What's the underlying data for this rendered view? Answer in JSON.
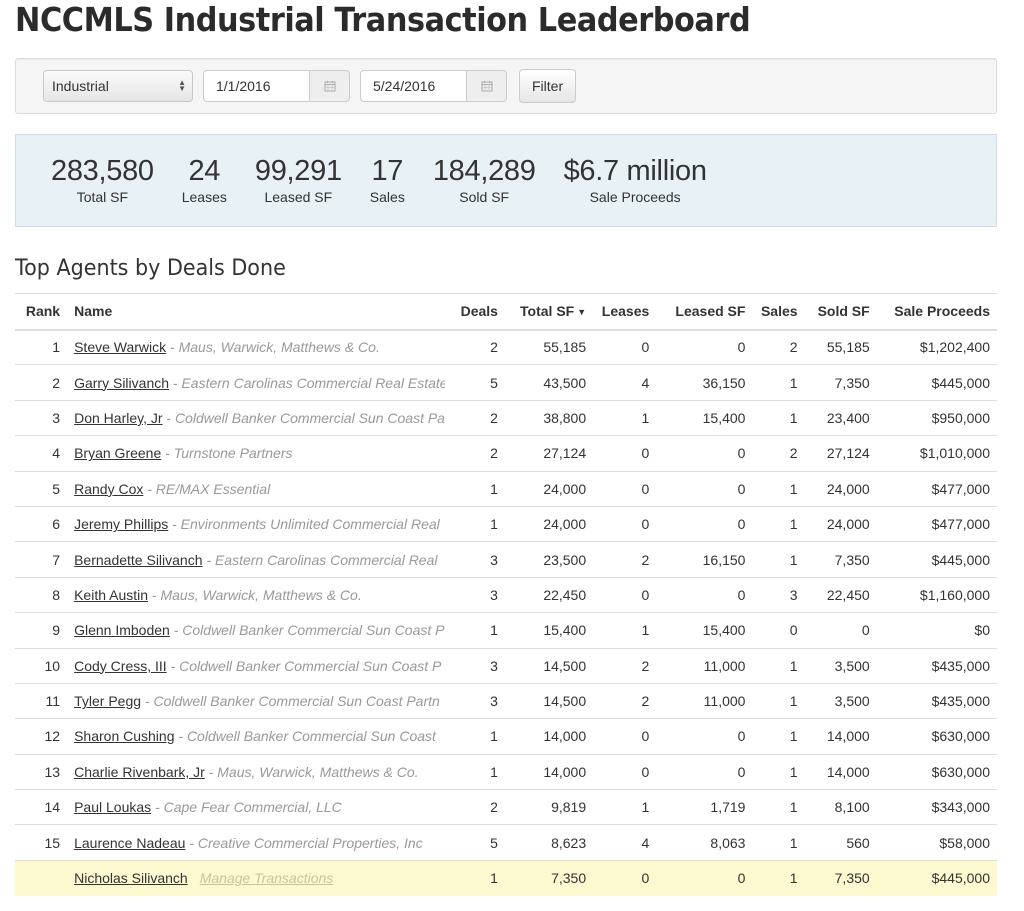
{
  "page": {
    "title": "NCCMLS Industrial Transaction Leaderboard",
    "section_title": "Top Agents by Deals Done"
  },
  "filters": {
    "property_type": "Industrial",
    "start_date": "1/1/2016",
    "end_date": "5/24/2016",
    "filter_label": "Filter",
    "calendar_icon": "calendar-icon"
  },
  "stats": [
    {
      "value": "283,580",
      "label": "Total SF"
    },
    {
      "value": "24",
      "label": "Leases"
    },
    {
      "value": "99,291",
      "label": "Leased SF"
    },
    {
      "value": "17",
      "label": "Sales"
    },
    {
      "value": "184,289",
      "label": "Sold SF"
    },
    {
      "value": "$6.7 million",
      "label": "Sale Proceeds"
    }
  ],
  "table": {
    "columns": [
      "Rank",
      "Name",
      "Deals",
      "Total SF",
      "Leases",
      "Leased SF",
      "Sales",
      "Sold SF",
      "Sale Proceeds"
    ],
    "sorted_column": "Total SF",
    "sort_direction": "descending",
    "rows": [
      {
        "rank": "1",
        "name": "Steve Warwick",
        "company": "Maus, Warwick, Matthews & Co.",
        "deals": "2",
        "total_sf": "55,185",
        "leases": "0",
        "leased_sf": "0",
        "sales": "2",
        "sold_sf": "55,185",
        "proceeds": "$1,202,400"
      },
      {
        "rank": "2",
        "name": "Garry Silivanch",
        "company": "Eastern Carolinas Commercial Real Estate",
        "deals": "5",
        "total_sf": "43,500",
        "leases": "4",
        "leased_sf": "36,150",
        "sales": "1",
        "sold_sf": "7,350",
        "proceeds": "$445,000"
      },
      {
        "rank": "3",
        "name": "Don Harley, Jr",
        "company": "Coldwell Banker Commercial Sun Coast Pa",
        "deals": "2",
        "total_sf": "38,800",
        "leases": "1",
        "leased_sf": "15,400",
        "sales": "1",
        "sold_sf": "23,400",
        "proceeds": "$950,000"
      },
      {
        "rank": "4",
        "name": "Bryan Greene",
        "company": "Turnstone Partners",
        "deals": "2",
        "total_sf": "27,124",
        "leases": "0",
        "leased_sf": "0",
        "sales": "2",
        "sold_sf": "27,124",
        "proceeds": "$1,010,000"
      },
      {
        "rank": "5",
        "name": "Randy Cox",
        "company": "RE/MAX Essential",
        "deals": "1",
        "total_sf": "24,000",
        "leases": "0",
        "leased_sf": "0",
        "sales": "1",
        "sold_sf": "24,000",
        "proceeds": "$477,000"
      },
      {
        "rank": "6",
        "name": "Jeremy Phillips",
        "company": "Environments Unlimited Commercial Real",
        "deals": "1",
        "total_sf": "24,000",
        "leases": "0",
        "leased_sf": "0",
        "sales": "1",
        "sold_sf": "24,000",
        "proceeds": "$477,000"
      },
      {
        "rank": "7",
        "name": "Bernadette Silivanch",
        "company": "Eastern Carolinas Commercial Real",
        "deals": "3",
        "total_sf": "23,500",
        "leases": "2",
        "leased_sf": "16,150",
        "sales": "1",
        "sold_sf": "7,350",
        "proceeds": "$445,000"
      },
      {
        "rank": "8",
        "name": "Keith Austin",
        "company": "Maus, Warwick, Matthews & Co.",
        "deals": "3",
        "total_sf": "22,450",
        "leases": "0",
        "leased_sf": "0",
        "sales": "3",
        "sold_sf": "22,450",
        "proceeds": "$1,160,000"
      },
      {
        "rank": "9",
        "name": "Glenn Imboden",
        "company": "Coldwell Banker Commercial Sun Coast P",
        "deals": "1",
        "total_sf": "15,400",
        "leases": "1",
        "leased_sf": "15,400",
        "sales": "0",
        "sold_sf": "0",
        "proceeds": "$0"
      },
      {
        "rank": "10",
        "name": "Cody Cress, III",
        "company": "Coldwell Banker Commercial Sun Coast P",
        "deals": "3",
        "total_sf": "14,500",
        "leases": "2",
        "leased_sf": "11,000",
        "sales": "1",
        "sold_sf": "3,500",
        "proceeds": "$435,000"
      },
      {
        "rank": "11",
        "name": "Tyler Pegg",
        "company": "Coldwell Banker Commercial Sun Coast Partn",
        "deals": "3",
        "total_sf": "14,500",
        "leases": "2",
        "leased_sf": "11,000",
        "sales": "1",
        "sold_sf": "3,500",
        "proceeds": "$435,000"
      },
      {
        "rank": "12",
        "name": "Sharon Cushing",
        "company": "Coldwell Banker Commercial Sun Coast",
        "deals": "1",
        "total_sf": "14,000",
        "leases": "0",
        "leased_sf": "0",
        "sales": "1",
        "sold_sf": "14,000",
        "proceeds": "$630,000"
      },
      {
        "rank": "13",
        "name": "Charlie Rivenbark, Jr",
        "company": "Maus, Warwick, Matthews & Co.",
        "deals": "1",
        "total_sf": "14,000",
        "leases": "0",
        "leased_sf": "0",
        "sales": "1",
        "sold_sf": "14,000",
        "proceeds": "$630,000"
      },
      {
        "rank": "14",
        "name": "Paul Loukas",
        "company": "Cape Fear Commercial, LLC",
        "deals": "2",
        "total_sf": "9,819",
        "leases": "1",
        "leased_sf": "1,719",
        "sales": "1",
        "sold_sf": "8,100",
        "proceeds": "$343,000"
      },
      {
        "rank": "15",
        "name": "Laurence Nadeau",
        "company": "Creative Commercial Properties, Inc",
        "deals": "5",
        "total_sf": "8,623",
        "leases": "4",
        "leased_sf": "8,063",
        "sales": "1",
        "sold_sf": "560",
        "proceeds": "$58,000"
      }
    ],
    "current_user_row": {
      "rank": "",
      "name": "Nicholas Silivanch",
      "action_label": "Manage Transactions",
      "deals": "1",
      "total_sf": "7,350",
      "leases": "0",
      "leased_sf": "0",
      "sales": "1",
      "sold_sf": "7,350",
      "proceeds": "$445,000"
    }
  },
  "colors": {
    "link_blue": "#336699",
    "money_green": "#5e9144",
    "stats_bg": "#e8f1f5",
    "highlight_bg": "#fcf8d0"
  }
}
